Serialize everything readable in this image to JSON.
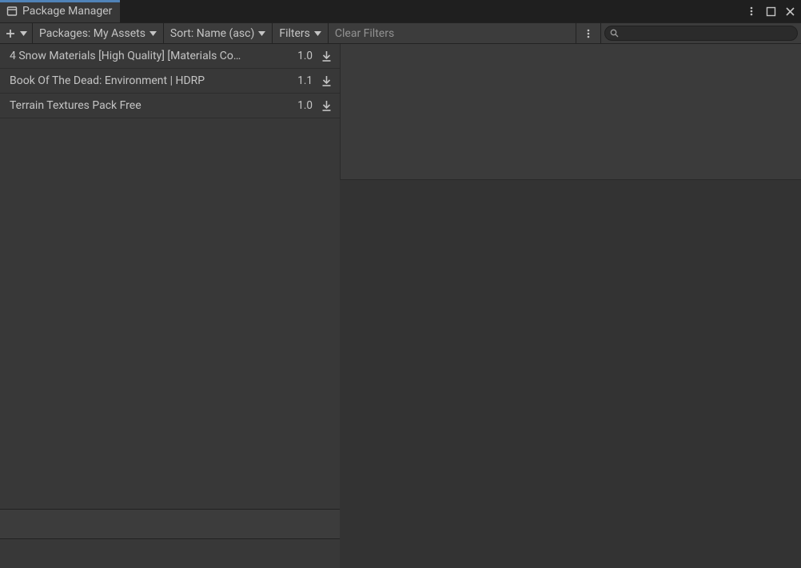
{
  "window": {
    "tab_title": "Package Manager"
  },
  "toolbar": {
    "packages_label": "Packages: My Assets",
    "sort_label": "Sort: Name (asc)",
    "filters_label": "Filters",
    "clear_filters_label": "Clear Filters",
    "search_placeholder": ""
  },
  "packages": [
    {
      "name": "4 Snow Materials [High Quality] [Materials Co…",
      "version": "1.0"
    },
    {
      "name": "Book Of The Dead: Environment | HDRP",
      "version": "1.1"
    },
    {
      "name": "Terrain Textures Pack Free",
      "version": "1.0"
    }
  ]
}
